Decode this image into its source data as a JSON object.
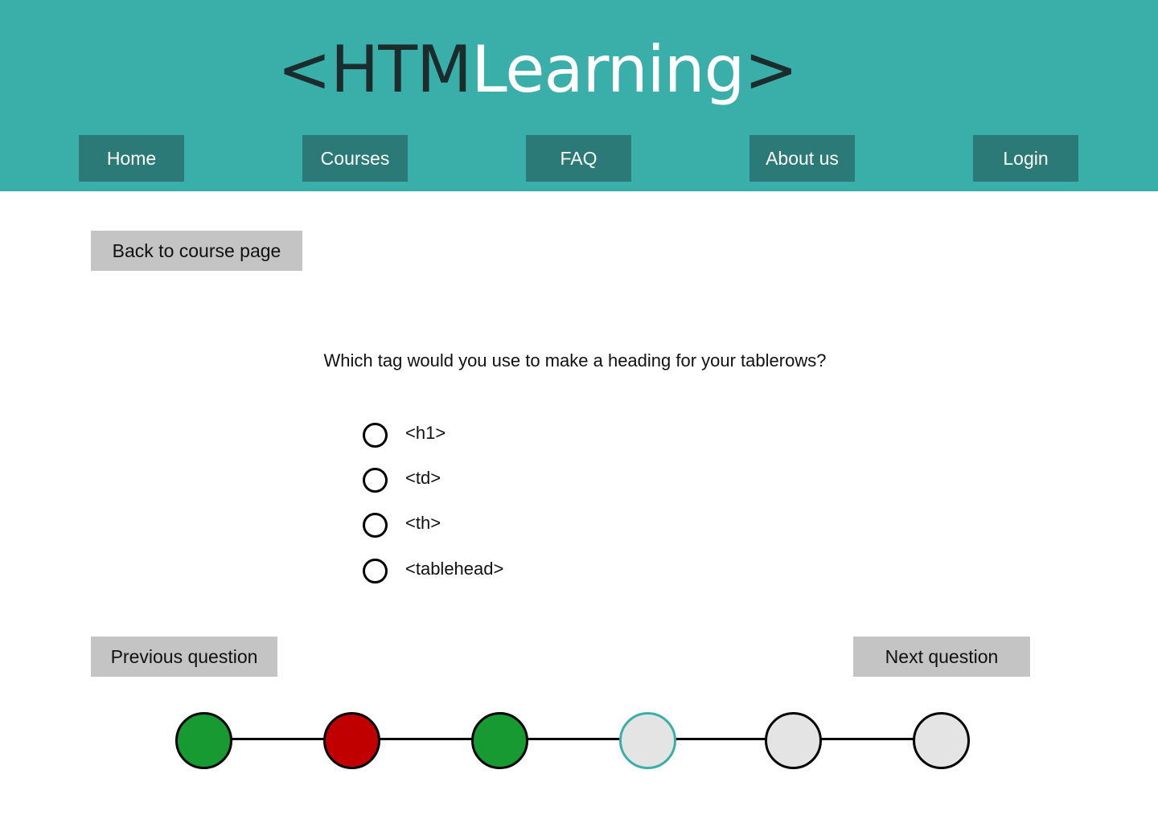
{
  "logo": {
    "open_bracket": "<",
    "part_dark": "HTM",
    "part_light": "Learning",
    "close_bracket": ">"
  },
  "nav": {
    "items": [
      {
        "label": "Home"
      },
      {
        "label": "Courses"
      },
      {
        "label": "FAQ"
      },
      {
        "label": "About us"
      },
      {
        "label": "Login"
      }
    ]
  },
  "back_button": {
    "label": "Back to course page"
  },
  "question": {
    "text": "Which tag would you use to make a heading for your tablerows?",
    "options": [
      {
        "label": "<h1>",
        "selected": false
      },
      {
        "label": "<td>",
        "selected": false
      },
      {
        "label": "<th>",
        "selected": false
      },
      {
        "label": "<tablehead>",
        "selected": false
      }
    ]
  },
  "navigation": {
    "previous_label": "Previous question",
    "next_label": "Next question"
  },
  "progress": {
    "steps": [
      {
        "status": "correct",
        "color": "#169a31"
      },
      {
        "status": "incorrect",
        "color": "#c00000"
      },
      {
        "status": "correct",
        "color": "#169a31"
      },
      {
        "status": "current",
        "color": "#e4e4e4",
        "border": "#3aafa9"
      },
      {
        "status": "unanswered",
        "color": "#e4e4e4"
      },
      {
        "status": "unanswered",
        "color": "#e4e4e4"
      }
    ]
  },
  "colors": {
    "header_bg": "#3aafa9",
    "nav_button_bg": "#2b7a78",
    "grey_button_bg": "#c4c4c4"
  }
}
